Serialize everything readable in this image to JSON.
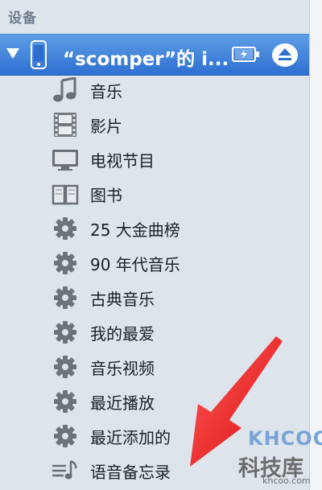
{
  "sidebar": {
    "section_title": "设备",
    "device": {
      "name": "“scomper”的 i...",
      "icon": "iphone-icon"
    },
    "items": [
      {
        "label": "音乐",
        "icon": "music-note-icon"
      },
      {
        "label": "影片",
        "icon": "film-icon"
      },
      {
        "label": "电视节目",
        "icon": "tv-icon"
      },
      {
        "label": "图书",
        "icon": "book-icon"
      },
      {
        "label": "25 大金曲榜",
        "icon": "gear-icon"
      },
      {
        "label": "90 年代音乐",
        "icon": "gear-icon"
      },
      {
        "label": "古典音乐",
        "icon": "gear-icon"
      },
      {
        "label": "我的最爱",
        "icon": "gear-icon"
      },
      {
        "label": "音乐视频",
        "icon": "gear-icon"
      },
      {
        "label": "最近播放",
        "icon": "gear-icon"
      },
      {
        "label": "最近添加的",
        "icon": "gear-icon"
      },
      {
        "label": "语音备忘录",
        "icon": "voice-memo-icon"
      }
    ]
  },
  "watermark": {
    "logo_text": "KHCOO",
    "site_name": "科技库",
    "url": "khcoo.com"
  },
  "colors": {
    "sidebar_bg": "#dde4ec",
    "selection": "#3a78d6",
    "annotation_arrow": "#ee1c1c"
  }
}
